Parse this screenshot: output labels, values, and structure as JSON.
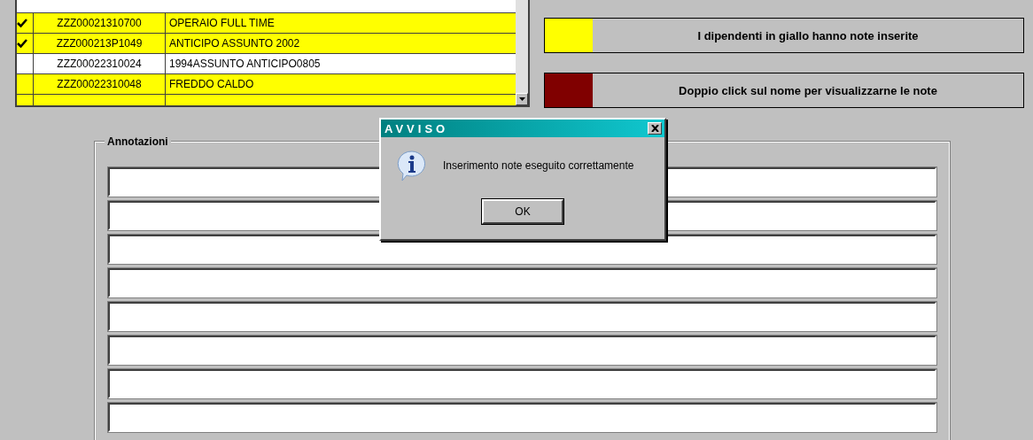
{
  "employees": {
    "rows": [
      {
        "checked": true,
        "code": "ZZZ00021310700",
        "description": "OPERAIO FULL TIME",
        "has_notes": true
      },
      {
        "checked": true,
        "code": "ZZZ000213P1049",
        "description": "ANTICIPO ASSUNTO 2002",
        "has_notes": true
      },
      {
        "checked": false,
        "code": "ZZZ00022310024",
        "description": "1994ASSUNTO ANTICIPO0805",
        "has_notes": false
      },
      {
        "checked": false,
        "code": "ZZZ00022310048",
        "description": "FREDDO CALDO",
        "has_notes": true
      }
    ]
  },
  "legend": [
    {
      "color": "#ffff00",
      "label": "I dipendenti in giallo hanno note inserite"
    },
    {
      "color": "#800000",
      "label": "Doppio click sul nome per visualizzarne le note"
    }
  ],
  "annotations": {
    "title": "Annotazioni"
  },
  "dialog": {
    "title": "AVVISO",
    "message": "Inserimento note eseguito correttamente",
    "button": "OK"
  }
}
